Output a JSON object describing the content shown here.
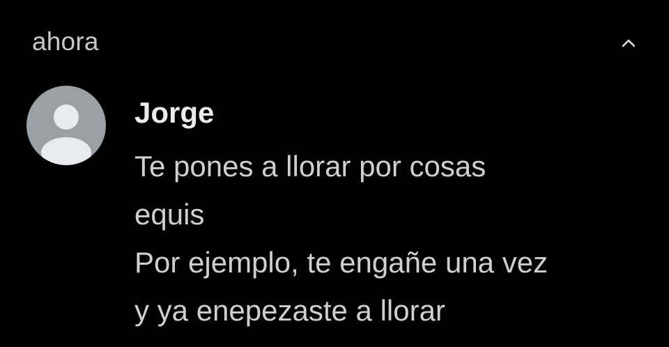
{
  "notification": {
    "timestamp": "ahora",
    "collapse_icon": "chevron-up-icon",
    "avatar_icon": "default-person-icon",
    "colors": {
      "background": "#000000",
      "avatar_bg": "#9aa0a6",
      "avatar_fg": "#e8eaed",
      "text": "#cfcfcf"
    },
    "sender": "Jorge",
    "message_lines": [
      "Te pones a llorar por cosas",
      "equis",
      "Por ejemplo, te engañe una vez",
      "y ya enepezaste a llorar"
    ]
  }
}
